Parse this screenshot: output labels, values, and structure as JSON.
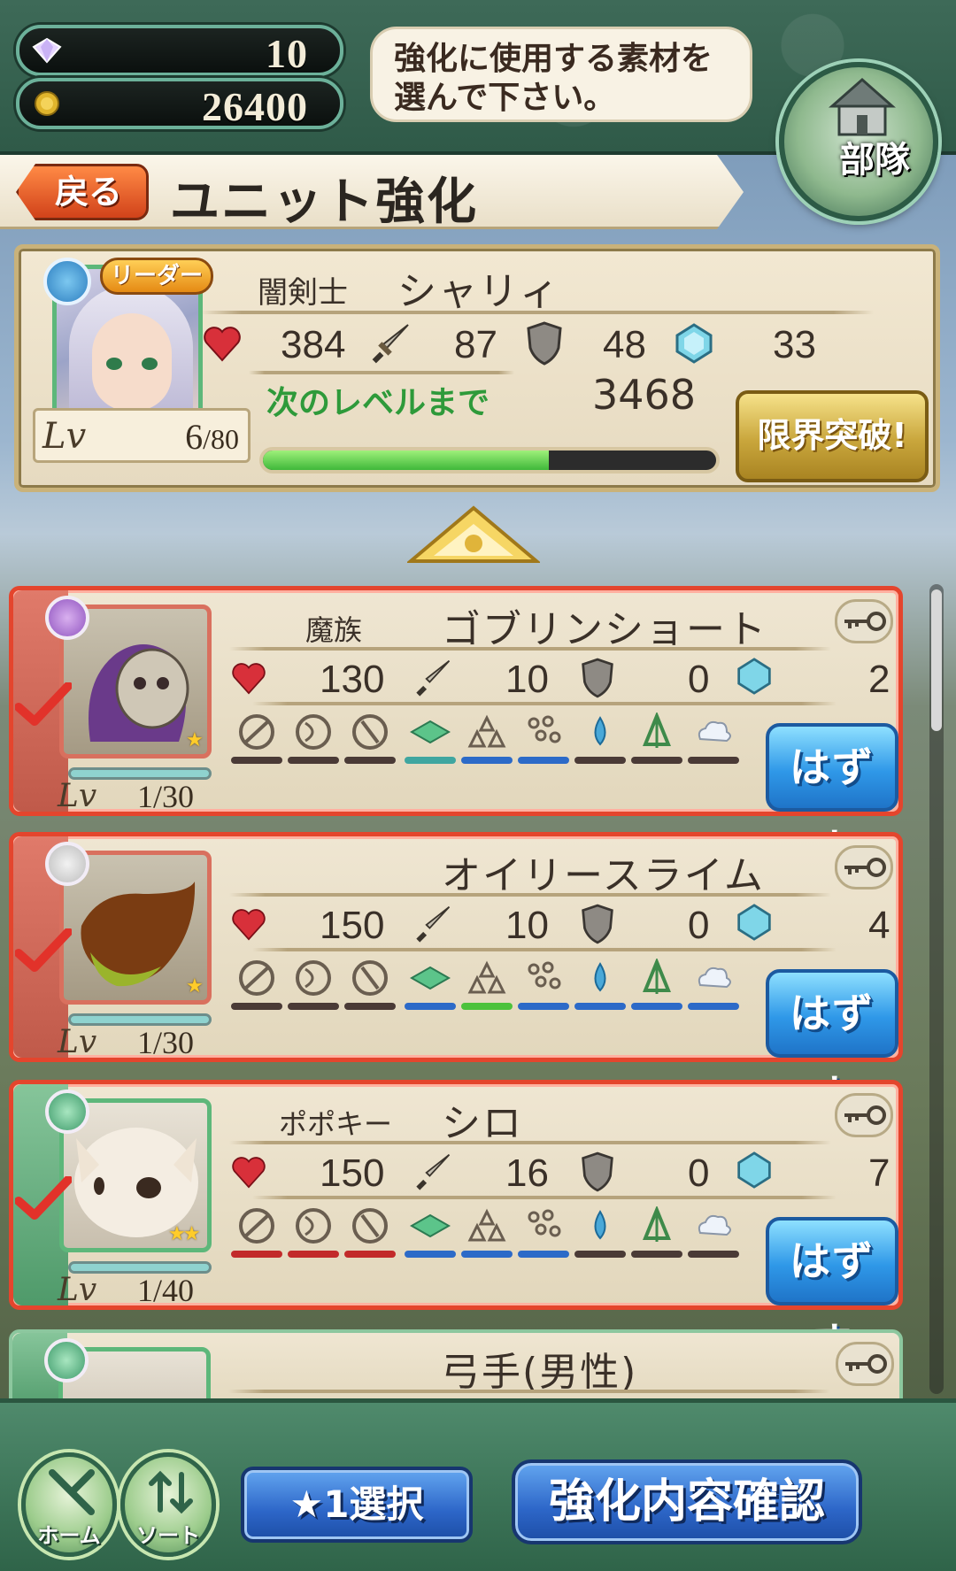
{
  "header": {
    "gems": "10",
    "gold": "26400",
    "hint": "強化に使用する素材を選んで下さい。",
    "squad_label": "部隊",
    "back_label": "戻る",
    "title": "ユニット強化"
  },
  "leader": {
    "tag": "リーダー",
    "class": "闇剣士",
    "name": "シャリィ",
    "stars": "★★★★",
    "hp": "384",
    "atk": "87",
    "def": "48",
    "mdef": "33",
    "next_label": "次のレベルまで",
    "next_exp": "3468",
    "exp_progress": 0.63,
    "lv_label": "Lv",
    "lv": "6",
    "lv_max": "/80",
    "limit_label": "限界突破!"
  },
  "materials": [
    {
      "class": "魔族",
      "name": "ゴブリンショート",
      "hp": "130",
      "atk": "10",
      "def": "0",
      "mdef": "2",
      "lv_label": "Lv",
      "lv": "1/30",
      "stars": "★",
      "remove_label": "はずす"
    },
    {
      "class": "",
      "name": "オイリースライム",
      "hp": "150",
      "atk": "10",
      "def": "0",
      "mdef": "4",
      "lv_label": "Lv",
      "lv": "1/30",
      "stars": "★",
      "remove_label": "はずす"
    },
    {
      "class": "ポポキー",
      "name": "シロ",
      "hp": "150",
      "atk": "16",
      "def": "0",
      "mdef": "7",
      "lv_label": "Lv",
      "lv": "1/40",
      "stars": "★★",
      "remove_label": "はずす"
    },
    {
      "class": "",
      "name": "弓手(男性)"
    }
  ],
  "footer": {
    "home_label": "ホーム",
    "sort_label": "ソート",
    "select_label": "★1選択",
    "confirm_label": "強化内容確認"
  },
  "colors": {
    "accent_green": "#2e9a3a",
    "selected_border": "#e4452d",
    "button_blue": "#2f98e8",
    "limit_gold": "#c9a63c"
  }
}
